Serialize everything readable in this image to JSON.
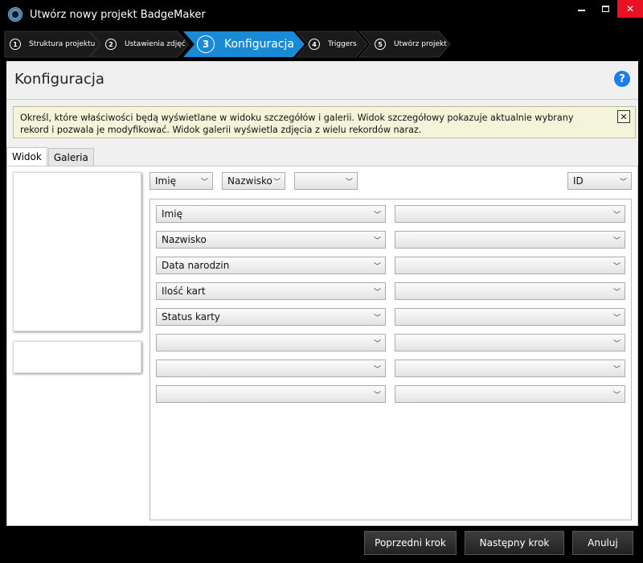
{
  "window": {
    "title": "Utwórz nowy projekt BadgeMaker"
  },
  "steps": [
    {
      "num": "1",
      "label": "Struktura projektu"
    },
    {
      "num": "2",
      "label": "Ustawienia zdjęć"
    },
    {
      "num": "3",
      "label": "Konfiguracja"
    },
    {
      "num": "4",
      "label": "Triggers"
    },
    {
      "num": "5",
      "label": "Utwórz projekt"
    }
  ],
  "header": {
    "title": "Konfiguracja",
    "help_glyph": "?"
  },
  "info": {
    "text": "Określ, które właściwości będą wyświetlane w widoku szczegółów i galerii. Widok szczegółowy pokazuje aktualnie wybrany rekord i pozwala je modyfikować. Widok galerii wyświetla zdjęcia z wielu rekordów naraz.",
    "close_glyph": "✕"
  },
  "tabs": [
    "Widok",
    "Galeria"
  ],
  "top_selectors": [
    "Imię",
    "Nazwisko",
    "",
    "ID"
  ],
  "field_rows": [
    {
      "left": "Imię",
      "right": ""
    },
    {
      "left": "Nazwisko",
      "right": ""
    },
    {
      "left": "Data narodzin",
      "right": ""
    },
    {
      "left": "Ilość kart",
      "right": ""
    },
    {
      "left": "Status karty",
      "right": ""
    },
    {
      "left": "",
      "right": ""
    },
    {
      "left": "",
      "right": ""
    },
    {
      "left": "",
      "right": ""
    }
  ],
  "footer": {
    "prev": "Poprzedni krok",
    "next": "Następny krok",
    "cancel": "Anuluj"
  }
}
